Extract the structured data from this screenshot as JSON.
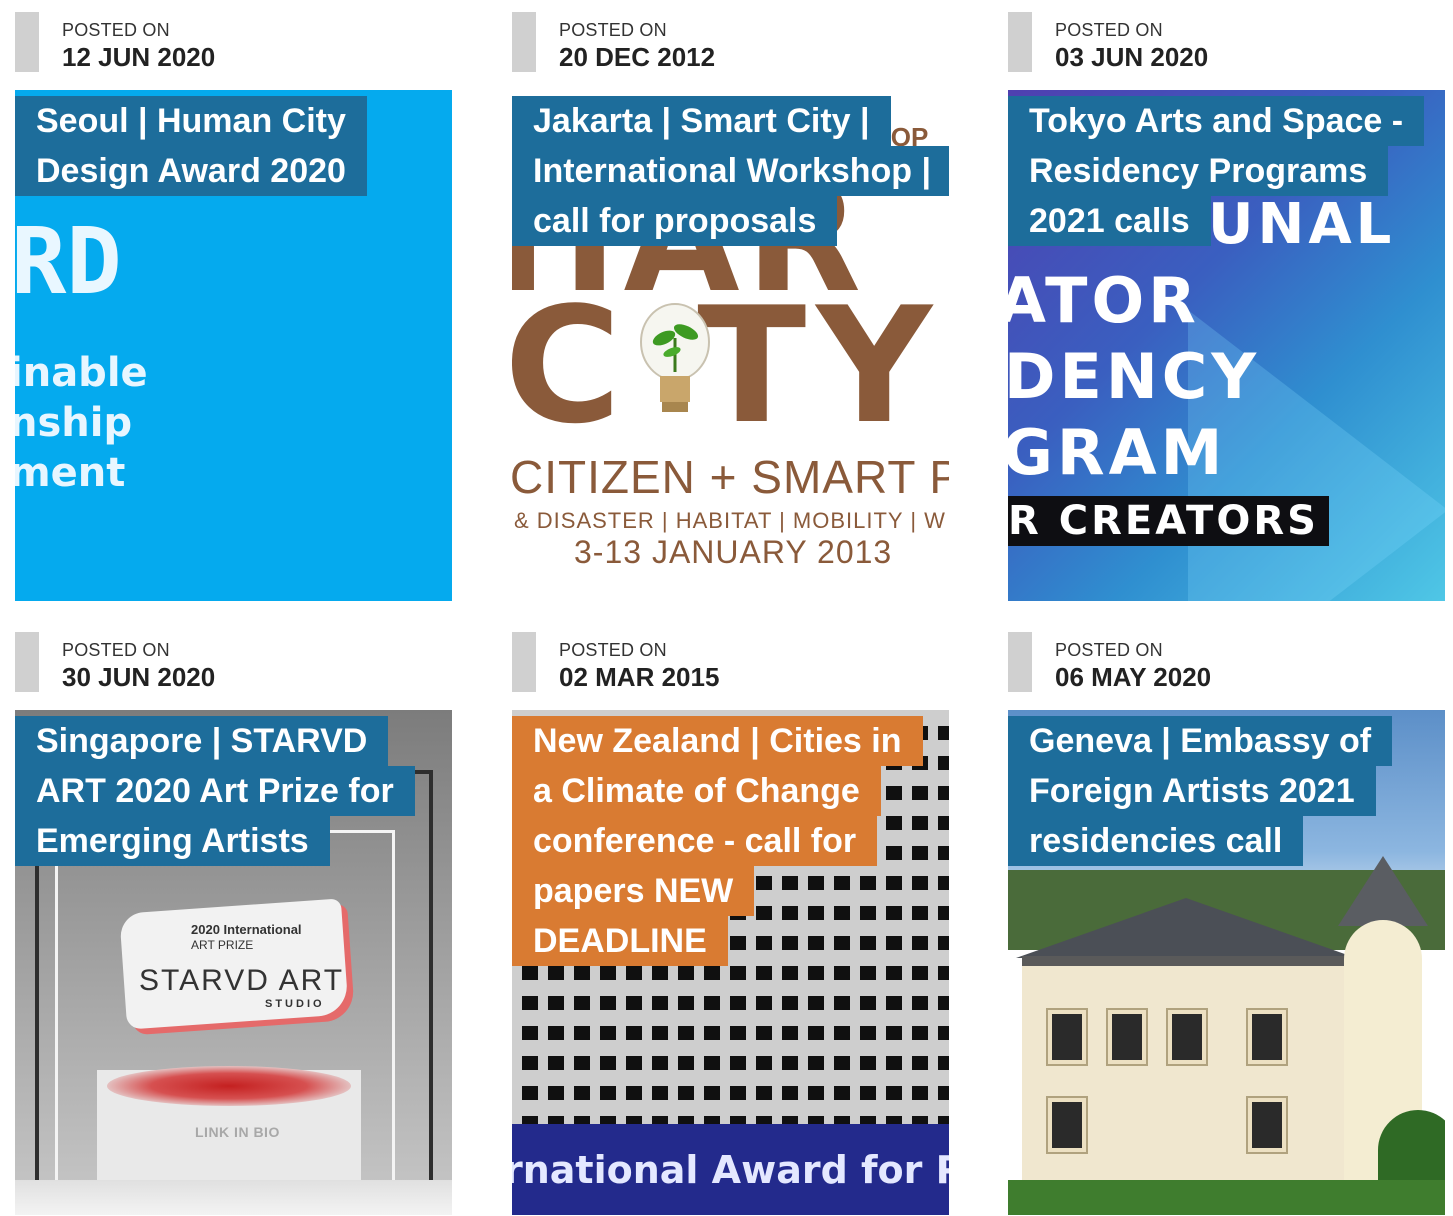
{
  "meta_label": "POSTED ON",
  "posts": [
    {
      "date": "12 JUN 2020",
      "title": "Seoul | Human City Design Award 2020",
      "title_color": "#1d6d9b",
      "image_text": {
        "big": "RD",
        "lines": [
          "inable",
          "nship",
          "ment"
        ]
      }
    },
    {
      "date": "20 DEC 2012",
      "title": "Jakarta | Smart City | International Workshop | call for proposals",
      "title_color": "#1d6d9b",
      "image_text": {
        "hop": "HOP",
        "big1": "HAR",
        "big2": "C  TY",
        "line1": "CITIZEN + SMART PI",
        "line2": "& DISASTER | HABITAT | MOBILITY | W",
        "line3": "3-13 JANUARY 2013"
      }
    },
    {
      "date": "03 JUN 2020",
      "title": "Tokyo Arts and Space - Residency Programs 2021 calls",
      "title_color": "#1d6d9b",
      "image_text": {
        "w1": "UNAL",
        "w2": "ATOR",
        "w3": "DENCY",
        "w4": "GRAM",
        "creators": "R CREATORS"
      }
    },
    {
      "date": "30 JUN 2020",
      "title": "Singapore | STARVD ART 2020 Art Prize for Emerging Artists",
      "title_color": "#1d6d9b",
      "image_text": {
        "p1": "2020 International",
        "p2": "ART PRIZE",
        "p3": "STARVD ART",
        "p4": "STUDIO",
        "link": "LINK IN BIO"
      }
    },
    {
      "date": "02 MAR 2015",
      "title": "New Zealand | Cities in a Climate of Change conference - call for papers NEW DEADLINE",
      "title_color": "#d97b32",
      "image_text": {
        "band": "rnational Award for P"
      }
    },
    {
      "date": "06 MAY 2020",
      "title": "Geneva | Embassy of Foreign Artists 2021 residencies call",
      "title_color": "#1d6d9b",
      "image_text": {}
    }
  ]
}
